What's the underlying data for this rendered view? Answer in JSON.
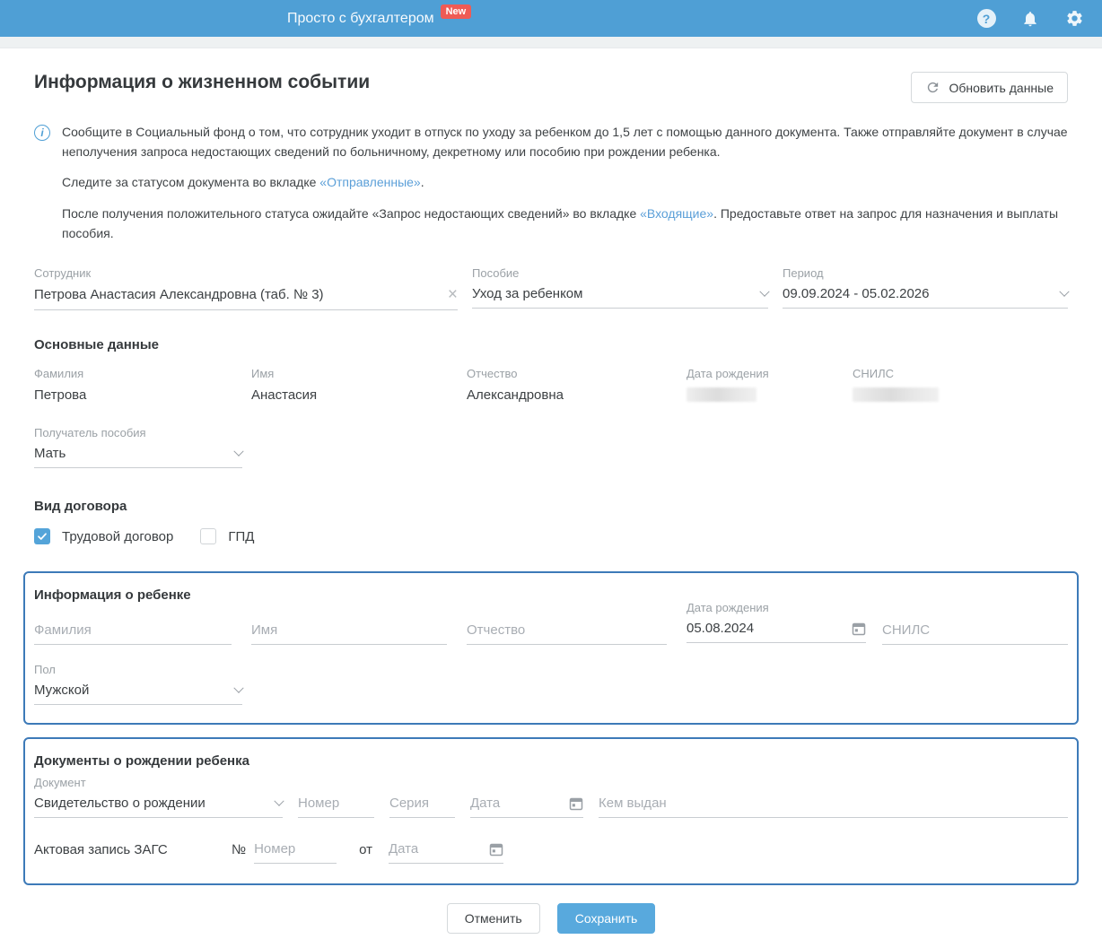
{
  "header": {
    "app_title": "Просто с бухгалтером",
    "badge": "New"
  },
  "icons": {
    "help": "?",
    "info": "i",
    "clear": "×"
  },
  "page": {
    "title": "Информация о жизненном событии",
    "refresh_button": "Обновить данные"
  },
  "info": {
    "p1": "Сообщите в Социальный фонд о том, что сотрудник уходит в отпуск по уходу за ребенком до 1,5 лет с помощью данного документа. Также отправляйте документ в случае неполучения запроса недостающих сведений по больничному, декретному или пособию при рождении ребенка.",
    "p2_prefix": "Следите за статусом документа во вкладке ",
    "p2_link": "«Отправленные»",
    "p2_suffix": ".",
    "p3_prefix": "После получения положительного статуса ожидайте «Запрос недостающих сведений» во вкладке ",
    "p3_link": "«Входящие»",
    "p3_suffix": ". Предоставьте ответ на запрос для назначения и выплаты пособия."
  },
  "fields": {
    "employee": {
      "label": "Сотрудник",
      "value": "Петрова Анастасия Александровна (таб. № 3)"
    },
    "benefit": {
      "label": "Пособие",
      "value": "Уход за ребенком"
    },
    "period": {
      "label": "Период",
      "value": "09.09.2024 - 05.02.2026"
    }
  },
  "main_data": {
    "title": "Основные данные",
    "last_name": {
      "label": "Фамилия",
      "value": "Петрова"
    },
    "first_name": {
      "label": "Имя",
      "value": "Анастасия"
    },
    "middle_name": {
      "label": "Отчество",
      "value": "Александровна"
    },
    "birth_date_label": "Дата рождения",
    "snils_label": "СНИЛС",
    "recipient": {
      "label": "Получатель пособия",
      "value": "Мать"
    }
  },
  "contract": {
    "title": "Вид договора",
    "options": [
      {
        "label": "Трудовой договор",
        "checked": true
      },
      {
        "label": "ГПД",
        "checked": false
      }
    ]
  },
  "child": {
    "title": "Информация о ребенке",
    "last_name_placeholder": "Фамилия",
    "first_name_placeholder": "Имя",
    "middle_name_placeholder": "Отчество",
    "birth_date": {
      "label": "Дата рождения",
      "value": "05.08.2024"
    },
    "snils_placeholder": "СНИЛС",
    "gender": {
      "label": "Пол",
      "value": "Мужской"
    }
  },
  "documents": {
    "title": "Документы о рождении ребенка",
    "doc_type": {
      "label": "Документ",
      "value": "Свидетельство о рождении"
    },
    "number_placeholder": "Номер",
    "series_placeholder": "Серия",
    "date_placeholder": "Дата",
    "issued_by_placeholder": "Кем выдан",
    "zags": {
      "label": "Актовая запись ЗАГС",
      "num_sign": "№",
      "number_placeholder": "Номер",
      "ot_label": "от",
      "date_placeholder": "Дата"
    }
  },
  "footer": {
    "cancel": "Отменить",
    "save": "Сохранить"
  },
  "colors": {
    "header_bg": "#4f9fd5",
    "badge_red": "#ef5b55",
    "link_blue": "#5b9fd8",
    "box_border": "#3d7ab8",
    "checkbox_blue": "#54a4d9",
    "save_button": "#58a9dd"
  }
}
